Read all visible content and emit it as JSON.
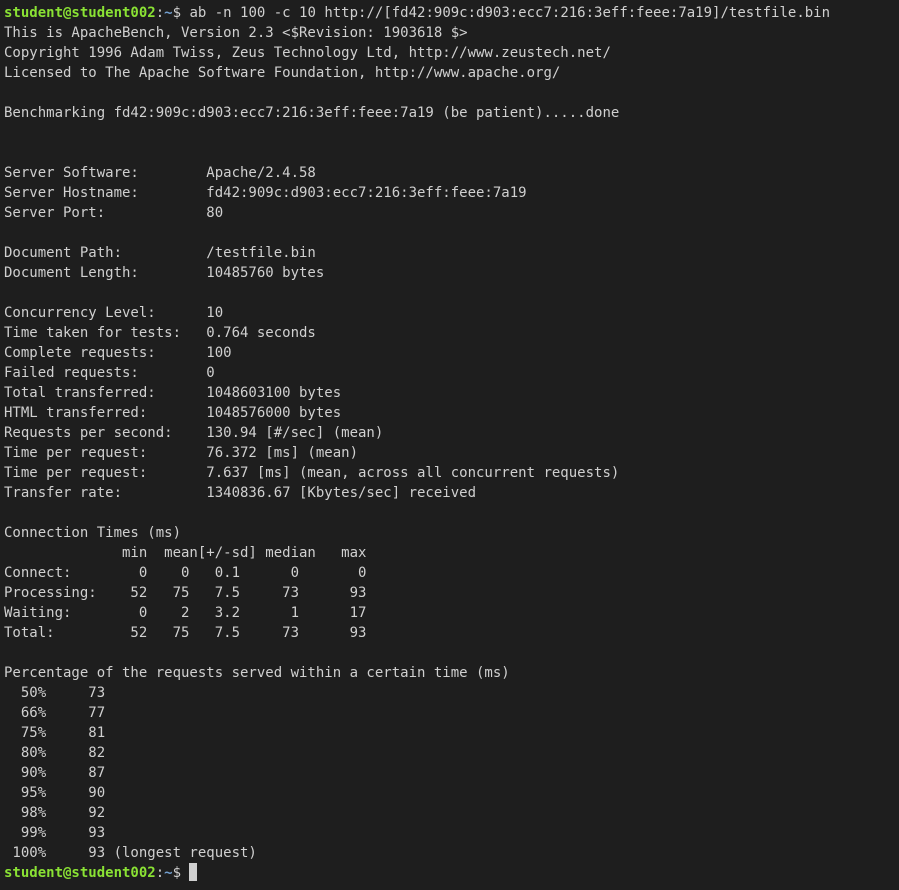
{
  "prompt": {
    "user_host": "student@student002",
    "separator": ":",
    "path": "~",
    "symbol": "$ "
  },
  "command": "ab -n 100 -c 10 http://[fd42:909c:d903:ecc7:216:3eff:feee:7a19]/testfile.bin",
  "output_lines": [
    "This is ApacheBench, Version 2.3 <$Revision: 1903618 $>",
    "Copyright 1996 Adam Twiss, Zeus Technology Ltd, http://www.zeustech.net/",
    "Licensed to The Apache Software Foundation, http://www.apache.org/",
    "",
    "Benchmarking fd42:909c:d903:ecc7:216:3eff:feee:7a19 (be patient).....done",
    "",
    "",
    "Server Software:        Apache/2.4.58",
    "Server Hostname:        fd42:909c:d903:ecc7:216:3eff:feee:7a19",
    "Server Port:            80",
    "",
    "Document Path:          /testfile.bin",
    "Document Length:        10485760 bytes",
    "",
    "Concurrency Level:      10",
    "Time taken for tests:   0.764 seconds",
    "Complete requests:      100",
    "Failed requests:        0",
    "Total transferred:      1048603100 bytes",
    "HTML transferred:       1048576000 bytes",
    "Requests per second:    130.94 [#/sec] (mean)",
    "Time per request:       76.372 [ms] (mean)",
    "Time per request:       7.637 [ms] (mean, across all concurrent requests)",
    "Transfer rate:          1340836.67 [Kbytes/sec] received",
    "",
    "Connection Times (ms)",
    "              min  mean[+/-sd] median   max",
    "Connect:        0    0   0.1      0       0",
    "Processing:    52   75   7.5     73      93",
    "Waiting:        0    2   3.2      1      17",
    "Total:         52   75   7.5     73      93",
    "",
    "Percentage of the requests served within a certain time (ms)",
    "  50%     73",
    "  66%     77",
    "  75%     81",
    "  80%     82",
    "  90%     87",
    "  95%     90",
    "  98%     92",
    "  99%     93",
    " 100%     93 (longest request)"
  ],
  "colors": {
    "background": "#1e1e1e",
    "foreground": "#d0d0d0",
    "prompt_user": "#8ae234",
    "prompt_path": "#729fcf"
  }
}
